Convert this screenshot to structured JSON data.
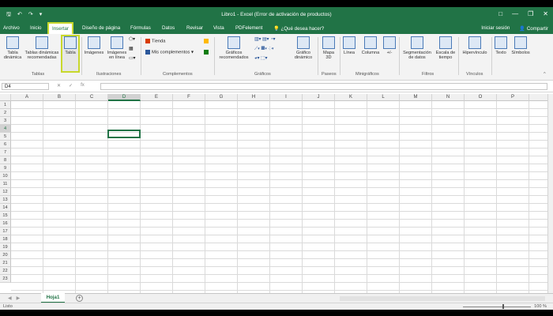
{
  "window": {
    "title": "Libro1 - Excel (Error de activación de productos)"
  },
  "qat": {
    "save_icon": "save-icon",
    "undo_icon": "undo-icon",
    "redo_icon": "redo-icon"
  },
  "window_controls": {
    "restore": "□",
    "minimize": "—",
    "maximize": "❐",
    "close": "✕"
  },
  "tabs": [
    {
      "label": "Archivo"
    },
    {
      "label": "Inicio"
    },
    {
      "label": "Insertar",
      "active": true
    },
    {
      "label": "Diseño de página"
    },
    {
      "label": "Fórmulas"
    },
    {
      "label": "Datos"
    },
    {
      "label": "Revisar"
    },
    {
      "label": "Vista"
    },
    {
      "label": "PDFelement"
    },
    {
      "label": "¿Qué desea hacer?"
    }
  ],
  "account": {
    "signin": "Iniciar sesión",
    "share": "Compartir"
  },
  "ribbon": {
    "tabla_dinamica": [
      "Tabla",
      "dinámica"
    ],
    "tablas_recomendadas": [
      "Tablas dinámicas",
      "recomendadas"
    ],
    "tabla": "Tabla",
    "imagenes": "Imágenes",
    "imagenes_linea": [
      "Imágenes",
      "en línea"
    ],
    "tienda": "Tienda",
    "mis_complementos": "Mis complementos",
    "graficos_recomendados": [
      "Gráficos",
      "recomendados"
    ],
    "grafico_dinamico": [
      "Gráfico",
      "dinámico"
    ],
    "mapa3d": [
      "Mapa",
      "3D"
    ],
    "linea": "Línea",
    "columna": "Columna",
    "ganancia": "+/-",
    "segmentacion": [
      "Segmentación",
      "de datos"
    ],
    "escala_tiempo": [
      "Escala de",
      "tiempo"
    ],
    "hipervinculo": "Hipervínculo",
    "texto": "Texto",
    "simbolos": "Símbolos",
    "groups": {
      "tablas": "Tablas",
      "ilustraciones": "Ilustraciones",
      "complementos": "Complementos",
      "graficos": "Gráficos",
      "paseos": "Paseos",
      "minigraficos": "Minigráficos",
      "filtros": "Filtros",
      "vinculos": "Vínculos"
    }
  },
  "formula_bar": {
    "name_box": "D4",
    "cancel": "✕",
    "enter": "✓",
    "fx": "fx",
    "formula": ""
  },
  "columns": [
    "A",
    "B",
    "C",
    "D",
    "E",
    "F",
    "G",
    "H",
    "I",
    "J",
    "K",
    "L",
    "M",
    "N",
    "O",
    "P"
  ],
  "rows": [
    "1",
    "2",
    "3",
    "4",
    "5",
    "6",
    "7",
    "8",
    "9",
    "10",
    "11",
    "12",
    "13",
    "14",
    "15",
    "16",
    "17",
    "18",
    "19",
    "20",
    "21",
    "22",
    "23"
  ],
  "selected": {
    "column": "D",
    "row": "4"
  },
  "sheets": [
    {
      "name": "Hoja1"
    }
  ],
  "add_sheet": "+",
  "status": {
    "text": "Listo",
    "zoom": "100 %"
  },
  "colors": {
    "brand": "#217346",
    "highlight": "#c8d82c"
  }
}
